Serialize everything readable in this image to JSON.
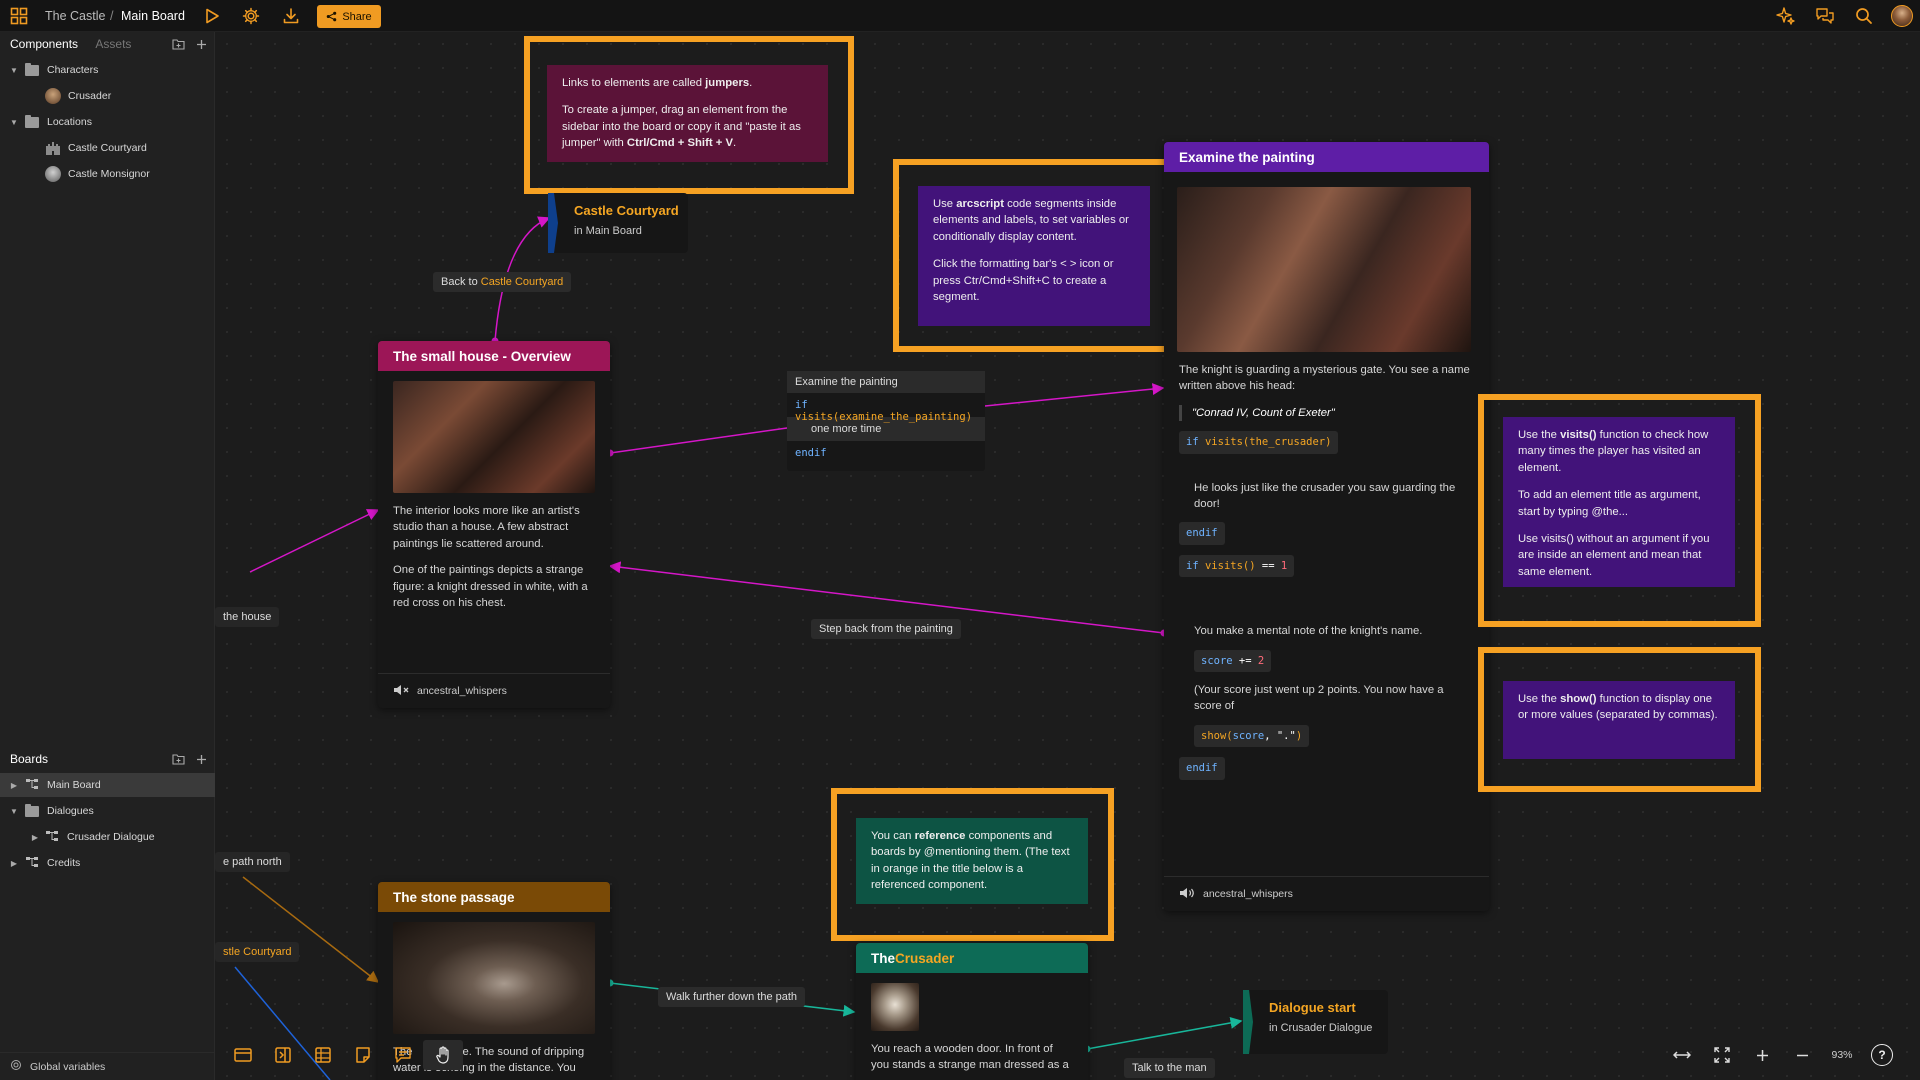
{
  "topbar": {
    "project": "The Castle",
    "separator": "/",
    "board": "Main Board",
    "share_label": "Share"
  },
  "sidebar": {
    "tab_components": "Components",
    "tab_assets": "Assets",
    "components": [
      {
        "label": "Characters",
        "type": "folder"
      },
      {
        "label": "Crusader",
        "type": "character"
      },
      {
        "label": "Locations",
        "type": "folder"
      },
      {
        "label": "Castle Courtyard",
        "type": "location"
      },
      {
        "label": "Castle Monsignor",
        "type": "location"
      }
    ],
    "boards_title": "Boards",
    "boards": [
      {
        "label": "Main Board"
      },
      {
        "label": "Dialogues"
      },
      {
        "label": "Crusader Dialogue"
      },
      {
        "label": "Credits"
      }
    ],
    "global_variables": "Global variables"
  },
  "canvas": {
    "note_jumpers": {
      "p1_pre": "Links to elements are called ",
      "p1_bold": "jumpers",
      "p1_post": ".",
      "p2_pre": "To create a jumper, drag an element from the sidebar into the board or copy it and \"paste it as jumper\" with ",
      "p2_bold": "Ctrl/Cmd + Shift + V",
      "p2_post": "."
    },
    "note_arcscript": {
      "p1_pre": "Use ",
      "p1_bold": "arcscript",
      "p1_post": " code segments inside elements and labels, to set variables or conditionally display content.",
      "p2": "Click the formatting bar's < > icon or press Ctr/Cmd+Shift+C to create a segment."
    },
    "note_visits": {
      "p1_pre": "Use the ",
      "p1_bold": "visits()",
      "p1_post": " function to check how many times the player has visited an element.",
      "p2": "To add an element title as argument, start by typing @the...",
      "p3": "Use visits() without an argument if you are inside an element and mean that same element."
    },
    "note_show": {
      "p1_pre": "Use the ",
      "p1_bold": "show()",
      "p1_post": " function to display one or more values (separated by commas)."
    },
    "note_reference": {
      "p1_pre": "You can ",
      "p1_bold": "reference",
      "p1_post": " components and boards by @mentioning them. (The text in orange in the title below is a referenced component."
    },
    "jumper_courtyard": {
      "title": "Castle Courtyard",
      "sub": "in Main Board"
    },
    "jumper_dialogue": {
      "title": "Dialogue start",
      "sub": "in Crusader Dialogue"
    },
    "label_back": {
      "pre": "Back to ",
      "ref": "Castle Courtyard"
    },
    "label_house": "the house",
    "label_path_north": "e path north",
    "label_stle": "stle Courtyard",
    "label_step_back": "Step back from the painting",
    "label_walk": "Walk further down the path",
    "label_talk": "Talk to the man",
    "cond_label": {
      "title": "Examine the painting",
      "code_if": "if",
      "code_fn": "visits(",
      "code_arg": "examine_the_painting",
      "code_close": ")",
      "text": "one more time",
      "code_endif": "endif"
    },
    "small_house": {
      "title": "The small house - Overview",
      "p1": "The interior looks more like an artist's studio than a house. A few abstract paintings lie scattered around.",
      "p2": "One of the paintings depicts a strange figure: a knight dressed in white, with a red cross on his chest.",
      "audio": "ancestral_whispers"
    },
    "painting": {
      "title": "Examine the painting",
      "p1": "The knight is guarding a mysterious gate. You see a name written above his head:",
      "quote": "\"Conrad IV, Count of Exeter\"",
      "c1_kw": "if",
      "c1_fn": "visits(",
      "c1_arg": "the_crusader",
      "c1_close": ")",
      "p2": "He looks just like the crusader you saw guarding the door!",
      "endif": "endif",
      "c2_kw": "if",
      "c2_fn": "visits()",
      "c2_op": " == ",
      "c2_num": "1",
      "p3": "You make a mental note of the knight's name.",
      "c3_var": "score",
      "c3_op": " += ",
      "c3_num": "2",
      "p4": "(Your score just went up 2 points. You now have a score of",
      "c4_fn": "show(",
      "c4_var": "score",
      "c4_str": ", \".\"",
      "c4_close": ")",
      "endif2": "endif",
      "audio": "ancestral_whispers"
    },
    "stone_passage": {
      "title": "The stone passage",
      "p1a": "The",
      "p1b": "e. The sound of dripping",
      "p1c": "water is echoing in the distance. You"
    },
    "crusader": {
      "title_pre": "The ",
      "title_ref": "Crusader",
      "p1": "You reach a wooden door. In front of",
      "p2": "you stands a strange man dressed as a"
    }
  },
  "zoom": "93%",
  "colors": {
    "accent": "#f09b22",
    "highlight": "#f6a123",
    "house_header": "#9c1657",
    "painting_header": "#5e1ea6",
    "passage_header": "#7a4a06",
    "crusader_header": "#0d6b56",
    "connector": "#d516c8"
  }
}
